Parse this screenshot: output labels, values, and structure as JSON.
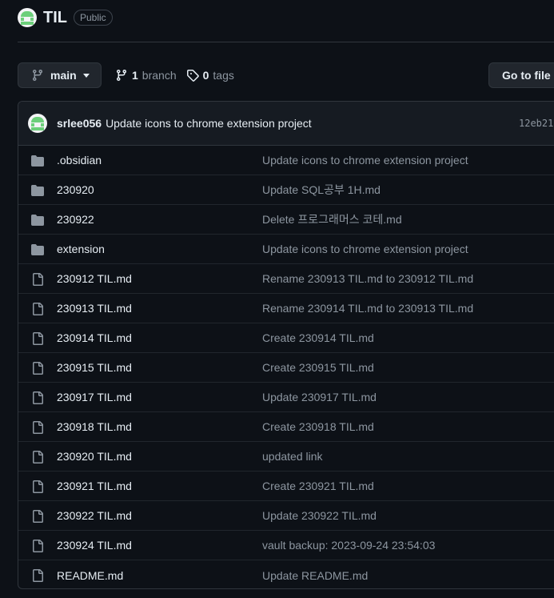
{
  "repo": {
    "name": "TIL",
    "visibility": "Public"
  },
  "toolbar": {
    "branch_label": "main",
    "branch_count": "1",
    "branch_word": "branch",
    "tag_count": "0",
    "tag_word": "tags",
    "goto_label": "Go to file"
  },
  "latest_commit": {
    "author": "srlee056",
    "message": "Update icons to chrome extension project",
    "sha": "12eb21"
  },
  "files": [
    {
      "name": ".obsidian",
      "type": "folder",
      "message": "Update icons to chrome extension project"
    },
    {
      "name": "230920",
      "type": "folder",
      "message": "Update SQL공부 1H.md"
    },
    {
      "name": "230922",
      "type": "folder",
      "message": "Delete 프로그래머스 코테.md"
    },
    {
      "name": "extension",
      "type": "folder",
      "message": "Update icons to chrome extension project"
    },
    {
      "name": "230912 TIL.md",
      "type": "file",
      "message": "Rename 230913 TIL.md to 230912 TIL.md"
    },
    {
      "name": "230913 TIL.md",
      "type": "file",
      "message": "Rename 230914 TIL.md to 230913 TIL.md"
    },
    {
      "name": "230914 TIL.md",
      "type": "file",
      "message": "Create 230914 TIL.md"
    },
    {
      "name": "230915 TIL.md",
      "type": "file",
      "message": "Create 230915 TIL.md"
    },
    {
      "name": "230917 TIL.md",
      "type": "file",
      "message": "Update 230917 TIL.md"
    },
    {
      "name": "230918 TIL.md",
      "type": "file",
      "message": "Create 230918 TIL.md"
    },
    {
      "name": "230920 TIL.md",
      "type": "file",
      "message": "updated link"
    },
    {
      "name": "230921 TIL.md",
      "type": "file",
      "message": "Create 230921 TIL.md"
    },
    {
      "name": "230922 TIL.md",
      "type": "file",
      "message": "Update 230922 TIL.md"
    },
    {
      "name": "230924 TIL.md",
      "type": "file",
      "message": "vault backup: 2023-09-24 23:54:03"
    },
    {
      "name": "README.md",
      "type": "file",
      "message": "Update README.md"
    }
  ],
  "colors": {
    "background": "#0d1117",
    "text": "#e6edf3",
    "muted": "#8d96a0",
    "border": "#30363d",
    "avatar_green": "#6ccf7a"
  }
}
